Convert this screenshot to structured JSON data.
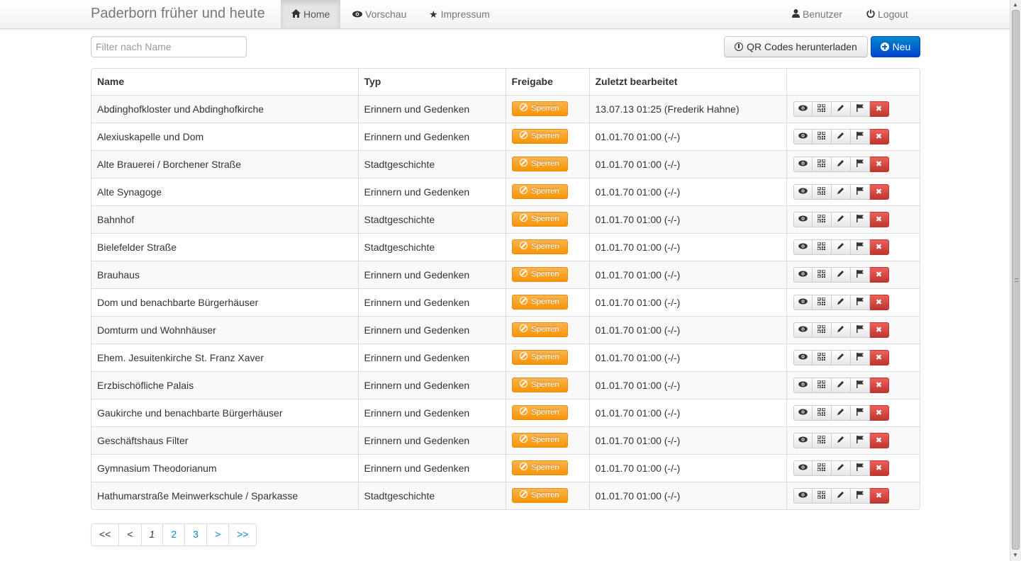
{
  "navbar": {
    "brand": "Paderborn früher und heute",
    "items": [
      {
        "label": "Home",
        "icon": "home-icon",
        "active": true
      },
      {
        "label": "Vorschau",
        "icon": "eye-icon"
      },
      {
        "label": "Impressum",
        "icon": "star-icon"
      }
    ],
    "right": [
      {
        "label": "Benutzer",
        "icon": "user-icon"
      },
      {
        "label": "Logout",
        "icon": "power-icon"
      }
    ]
  },
  "toolbar": {
    "filter_placeholder": "Filter nach Name",
    "qr_button": "QR Codes herunterladen",
    "new_button": "Neu"
  },
  "table": {
    "headers": [
      "Name",
      "Typ",
      "Freigabe",
      "Zuletzt bearbeitet",
      ""
    ],
    "lock_label": "Sperren",
    "rows": [
      {
        "name": "Abdinghofkloster und Abdinghofkirche",
        "type": "Erinnern und Gedenken",
        "edited": "13.07.13 01:25 (Frederik Hahne)"
      },
      {
        "name": "Alexiuskapelle und Dom",
        "type": "Erinnern und Gedenken",
        "edited": "01.01.70 01:00 (-/-)"
      },
      {
        "name": "Alte Brauerei / Borchener Straße",
        "type": "Stadtgeschichte",
        "edited": "01.01.70 01:00 (-/-)"
      },
      {
        "name": "Alte Synagoge",
        "type": "Erinnern und Gedenken",
        "edited": "01.01.70 01:00 (-/-)"
      },
      {
        "name": "Bahnhof",
        "type": "Stadtgeschichte",
        "edited": "01.01.70 01:00 (-/-)"
      },
      {
        "name": "Bielefelder Straße",
        "type": "Stadtgeschichte",
        "edited": "01.01.70 01:00 (-/-)"
      },
      {
        "name": "Brauhaus",
        "type": "Erinnern und Gedenken",
        "edited": "01.01.70 01:00 (-/-)"
      },
      {
        "name": "Dom und benachbarte Bürgerhäuser",
        "type": "Erinnern und Gedenken",
        "edited": "01.01.70 01:00 (-/-)"
      },
      {
        "name": "Domturm und Wohnhäuser",
        "type": "Erinnern und Gedenken",
        "edited": "01.01.70 01:00 (-/-)"
      },
      {
        "name": "Ehem. Jesuitenkirche St. Franz Xaver",
        "type": "Erinnern und Gedenken",
        "edited": "01.01.70 01:00 (-/-)"
      },
      {
        "name": "Erzbischöfliche Palais",
        "type": "Erinnern und Gedenken",
        "edited": "01.01.70 01:00 (-/-)"
      },
      {
        "name": "Gaukirche und benachbarte Bürgerhäuser",
        "type": "Erinnern und Gedenken",
        "edited": "01.01.70 01:00 (-/-)"
      },
      {
        "name": "Geschäftshaus Filter",
        "type": "Erinnern und Gedenken",
        "edited": "01.01.70 01:00 (-/-)"
      },
      {
        "name": "Gymnasium Theodorianum",
        "type": "Erinnern und Gedenken",
        "edited": "01.01.70 01:00 (-/-)"
      },
      {
        "name": "Hathumarstraße Meinwerkschule / Sparkasse",
        "type": "Stadtgeschichte",
        "edited": "01.01.70 01:00 (-/-)"
      }
    ]
  },
  "pagination": {
    "items": [
      "<<",
      "<",
      "1",
      "2",
      "3",
      ">",
      ">>"
    ],
    "current": "1"
  },
  "colors": {
    "primary": "#0044cc",
    "warning": "#f89406",
    "danger": "#bd362f",
    "link": "#0088cc"
  }
}
